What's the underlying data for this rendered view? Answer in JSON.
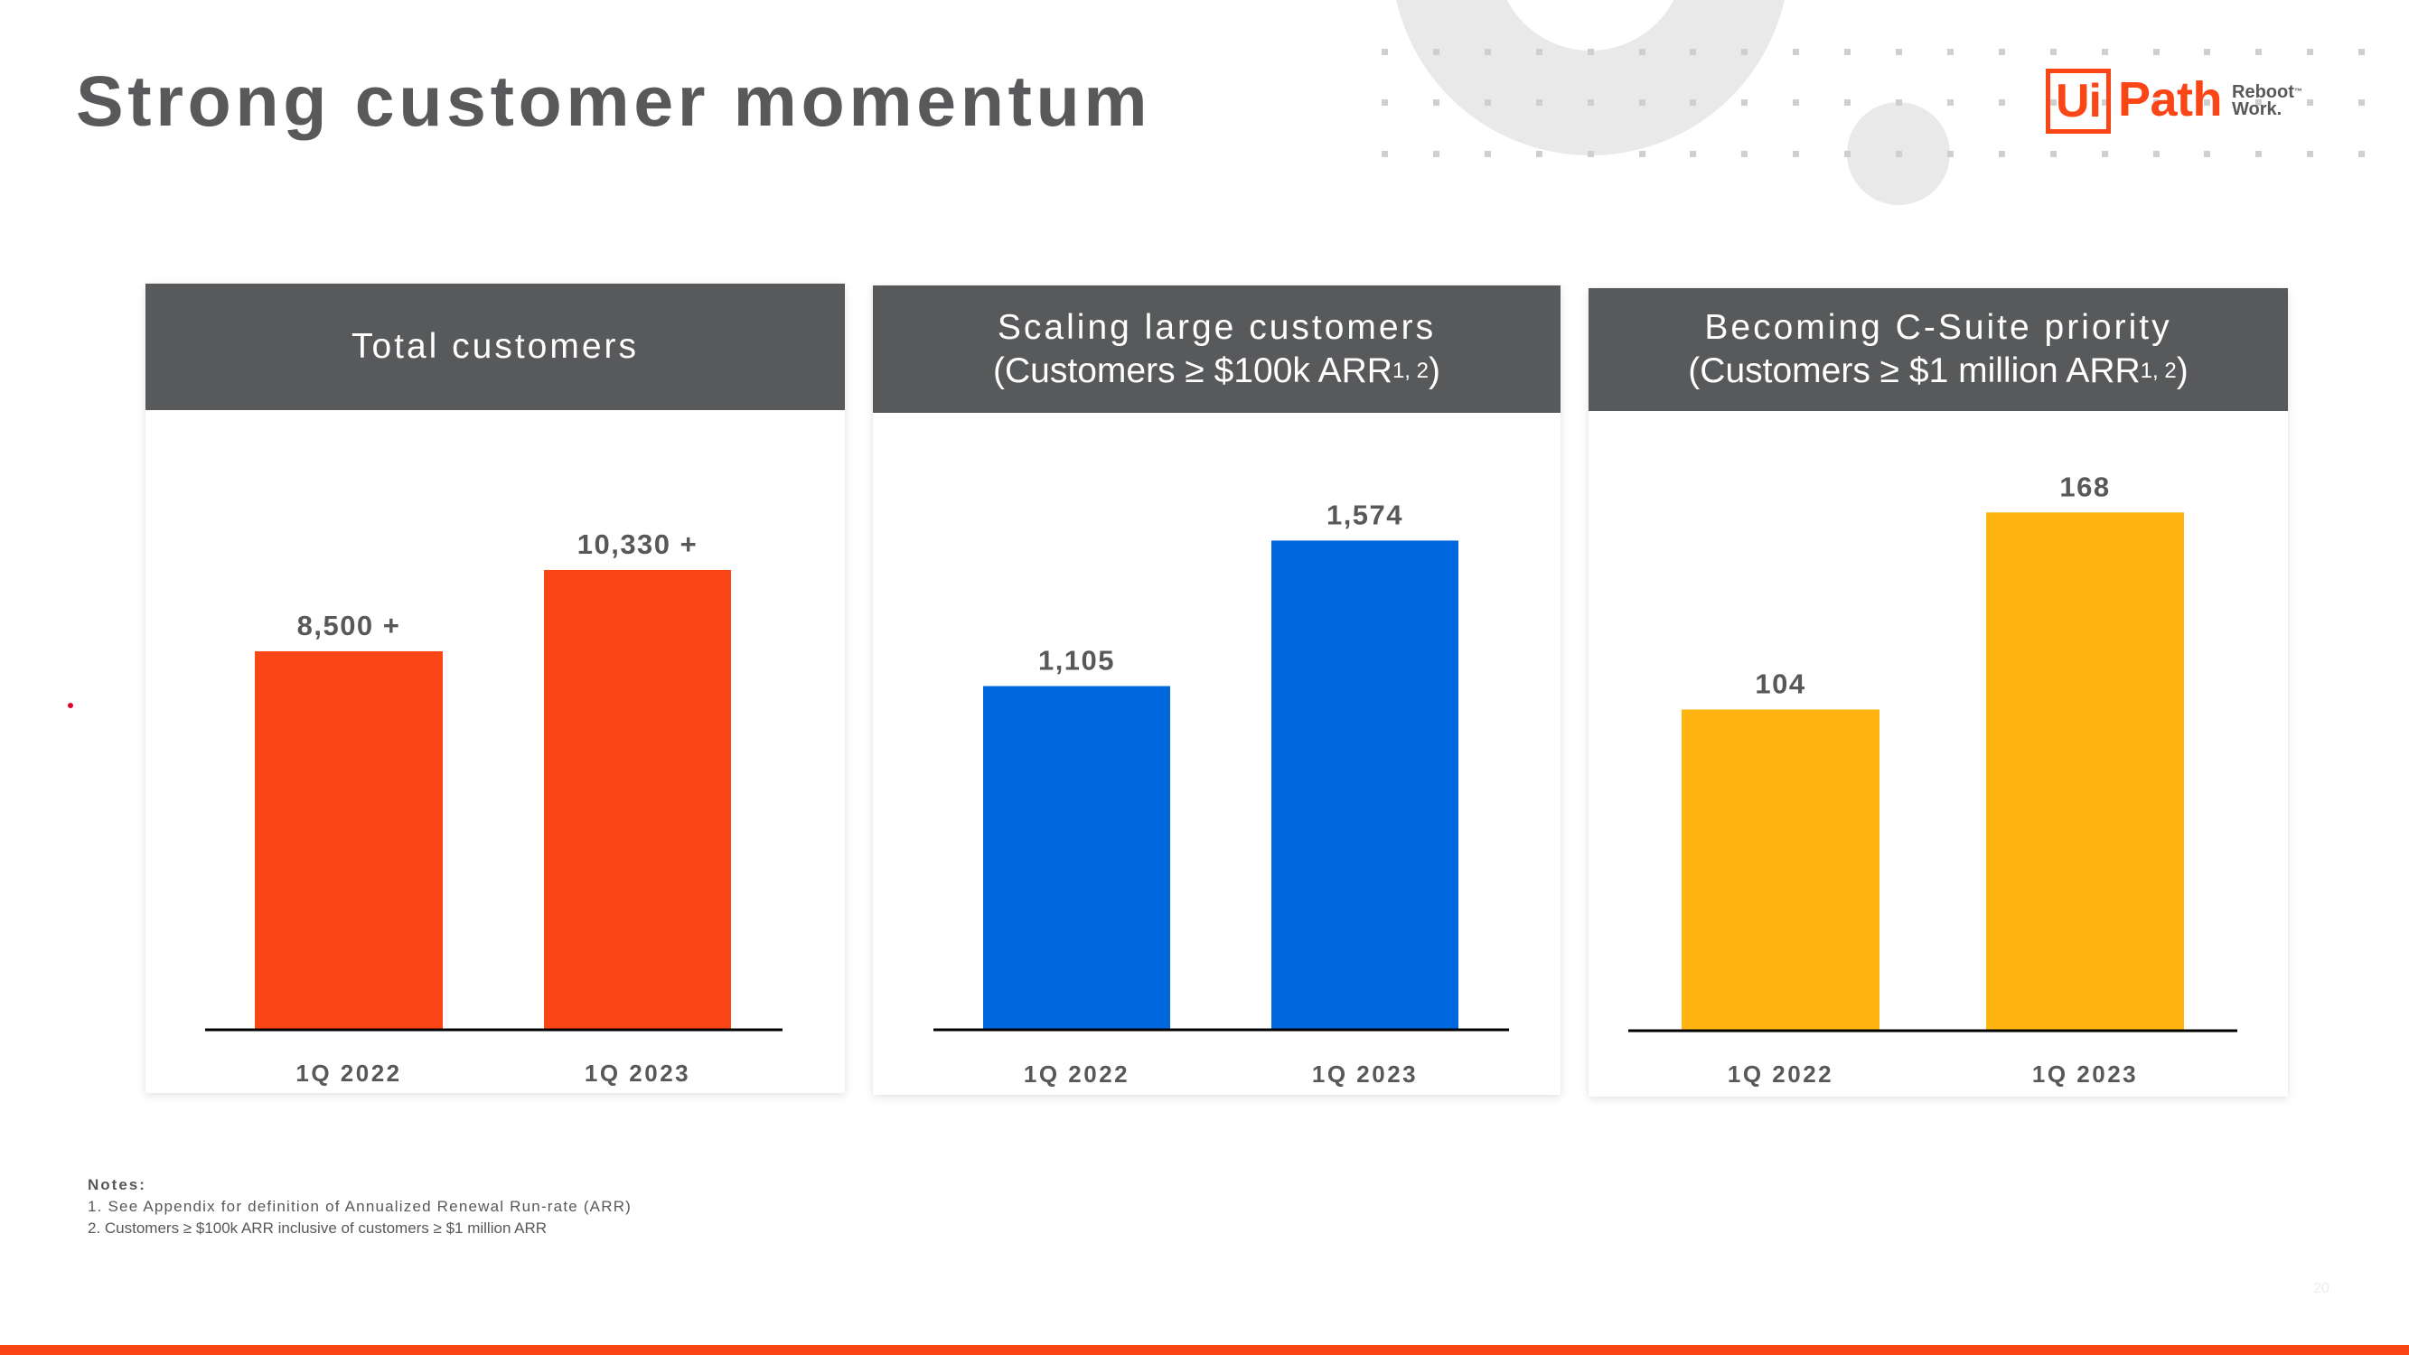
{
  "slide": {
    "title": "Strong customer momentum",
    "page_number": "20",
    "accent_color": "#fa4616"
  },
  "logo": {
    "brand_box": "Ui",
    "brand_word": "Path",
    "tagline_line1": "Reboot",
    "tagline_tm": "™",
    "tagline_line2": "Work."
  },
  "notes": {
    "title": "Notes:",
    "items": [
      "1. See Appendix for definition of Annualized Renewal Run-rate (ARR)",
      "2. Customers ≥ $100k ARR inclusive of customers ≥ $1 million ARR"
    ]
  },
  "chart_data": [
    {
      "type": "bar",
      "title": "Total customers",
      "subtitle": "",
      "title_superscript": "",
      "categories": [
        "1Q 2022",
        "1Q 2023"
      ],
      "values": [
        8500,
        10330
      ],
      "data_labels": [
        "8,500 +",
        "10,330 +"
      ],
      "color": "#fa4616",
      "xlabel": "",
      "ylabel": "",
      "ylim": [
        0,
        12200
      ],
      "grid": false,
      "legend": "none"
    },
    {
      "type": "bar",
      "title": "Scaling large customers",
      "subtitle": "(Customers ≥ $100k ARR",
      "title_superscript": "1, 2",
      "subtitle_close": ")",
      "categories": [
        "1Q 2022",
        "1Q 2023"
      ],
      "values": [
        1105,
        1574
      ],
      "data_labels": [
        "1,105",
        "1,574"
      ],
      "color": "#0067df",
      "xlabel": "",
      "ylabel": "",
      "ylim": [
        0,
        1747
      ],
      "grid": false,
      "legend": "none"
    },
    {
      "type": "bar",
      "title": "Becoming C-Suite priority",
      "subtitle": "(Customers ≥ $1 million ARR",
      "title_superscript": "1, 2",
      "subtitle_close": ")",
      "categories": [
        "1Q 2022",
        "1Q 2023"
      ],
      "values": [
        104,
        168
      ],
      "data_labels": [
        "104",
        "168"
      ],
      "color": "#ffb40f",
      "xlabel": "",
      "ylabel": "",
      "ylim": [
        0,
        176
      ],
      "grid": false,
      "legend": "none"
    }
  ]
}
